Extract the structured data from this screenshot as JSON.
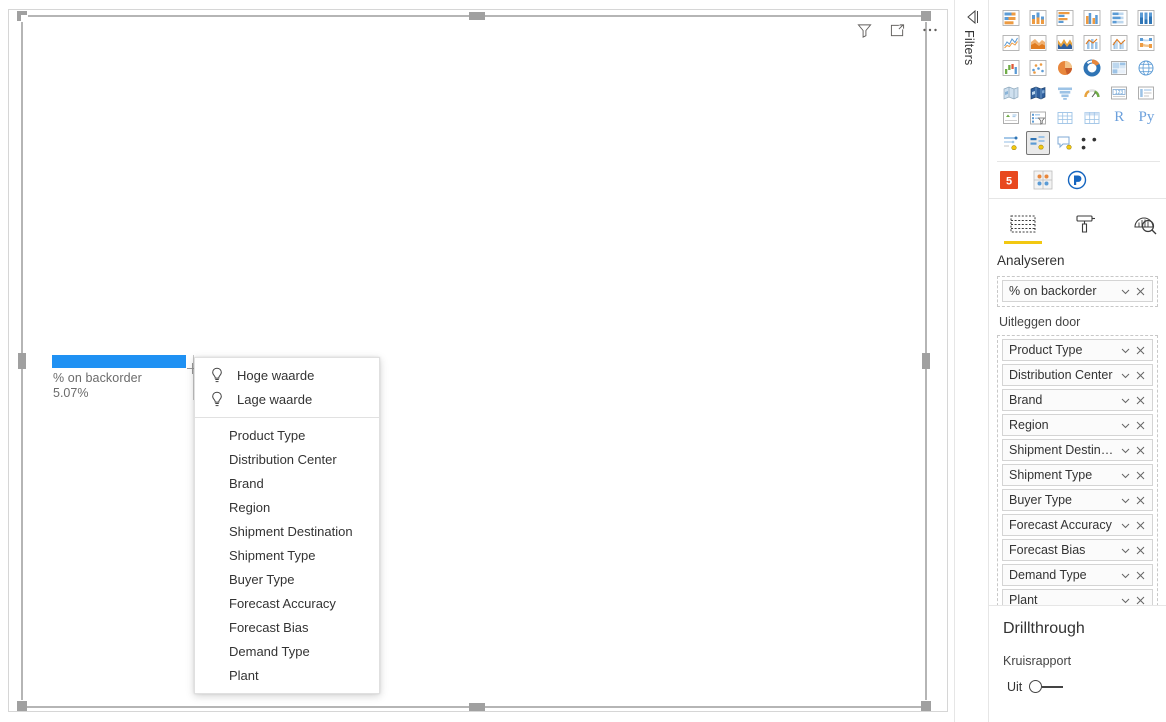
{
  "canvas": {
    "visual_header": {
      "filter_icon": "filter-icon",
      "focus_icon": "focus-mode-icon",
      "more_icon": "more-options-icon"
    },
    "kpi_visual": {
      "label": "% on backorder",
      "value": "5.07%",
      "bar_color": "#1f91f3"
    }
  },
  "context_menu": {
    "top_items": [
      {
        "label": "Hoge waarde",
        "icon": "lightbulb-icon"
      },
      {
        "label": "Lage waarde",
        "icon": "lightbulb-icon"
      }
    ],
    "field_items": [
      {
        "label": "Product Type"
      },
      {
        "label": "Distribution Center"
      },
      {
        "label": "Brand"
      },
      {
        "label": "Region"
      },
      {
        "label": "Shipment Destination"
      },
      {
        "label": "Shipment Type"
      },
      {
        "label": "Buyer Type"
      },
      {
        "label": "Forecast Accuracy"
      },
      {
        "label": "Forecast Bias"
      },
      {
        "label": "Demand Type"
      },
      {
        "label": "Plant"
      }
    ]
  },
  "filters_pane": {
    "label": "Filters",
    "expand_icon": "expand-pane-icon"
  },
  "visualizations": {
    "gallery": [
      {
        "name": "stacked-bar-chart-icon"
      },
      {
        "name": "stacked-column-chart-icon"
      },
      {
        "name": "clustered-bar-chart-icon"
      },
      {
        "name": "clustered-column-chart-icon"
      },
      {
        "name": "100-stacked-bar-chart-icon"
      },
      {
        "name": "100-stacked-column-chart-icon"
      },
      {
        "name": "line-chart-icon"
      },
      {
        "name": "area-chart-icon"
      },
      {
        "name": "stacked-area-chart-icon"
      },
      {
        "name": "line-stacked-column-chart-icon"
      },
      {
        "name": "line-clustered-column-chart-icon"
      },
      {
        "name": "ribbon-chart-icon"
      },
      {
        "name": "waterfall-chart-icon"
      },
      {
        "name": "scatter-chart-icon"
      },
      {
        "name": "pie-chart-icon"
      },
      {
        "name": "donut-chart-icon"
      },
      {
        "name": "treemap-icon"
      },
      {
        "name": "map-icon"
      },
      {
        "name": "filled-map-icon"
      },
      {
        "name": "shape-map-icon"
      },
      {
        "name": "funnel-chart-icon"
      },
      {
        "name": "gauge-icon"
      },
      {
        "name": "card-icon"
      },
      {
        "name": "multi-row-card-icon"
      },
      {
        "name": "kpi-icon"
      },
      {
        "name": "slicer-icon"
      },
      {
        "name": "table-icon"
      },
      {
        "name": "matrix-icon"
      },
      {
        "name": "r-script-visual-icon",
        "text": "R"
      },
      {
        "name": "python-visual-icon",
        "text": "Py"
      },
      {
        "name": "key-influencers-icon"
      },
      {
        "name": "decomposition-tree-icon",
        "selected": true
      },
      {
        "name": "qa-visual-icon"
      },
      {
        "name": "more-visuals-icon",
        "text": "• • •"
      }
    ],
    "custom_visuals": [
      {
        "name": "html-content-visual-icon"
      },
      {
        "name": "custom-visual-icon"
      },
      {
        "name": "power-bi-visual-icon"
      }
    ],
    "tabs": [
      {
        "name": "fields-tab",
        "icon": "fields-icon",
        "active": true
      },
      {
        "name": "format-tab",
        "icon": "paint-roller-icon",
        "active": false
      },
      {
        "name": "analytics-tab",
        "icon": "magnifier-chart-icon",
        "active": false
      }
    ],
    "active_tab_title": "Analyseren",
    "analyze_field": {
      "label": "% on backorder"
    },
    "explain_by_label": "Uitleggen door",
    "explain_by_fields": [
      {
        "label": "Product Type"
      },
      {
        "label": "Distribution Center"
      },
      {
        "label": "Brand"
      },
      {
        "label": "Region"
      },
      {
        "label": "Shipment Destination"
      },
      {
        "label": "Shipment Type"
      },
      {
        "label": "Buyer Type"
      },
      {
        "label": "Forecast Accuracy"
      },
      {
        "label": "Forecast Bias"
      },
      {
        "label": "Demand Type"
      },
      {
        "label": "Plant"
      }
    ]
  },
  "drillthrough": {
    "title": "Drillthrough",
    "cross_report_label": "Kruisrapport",
    "toggle_label": "Uit",
    "toggle_state": "off"
  }
}
